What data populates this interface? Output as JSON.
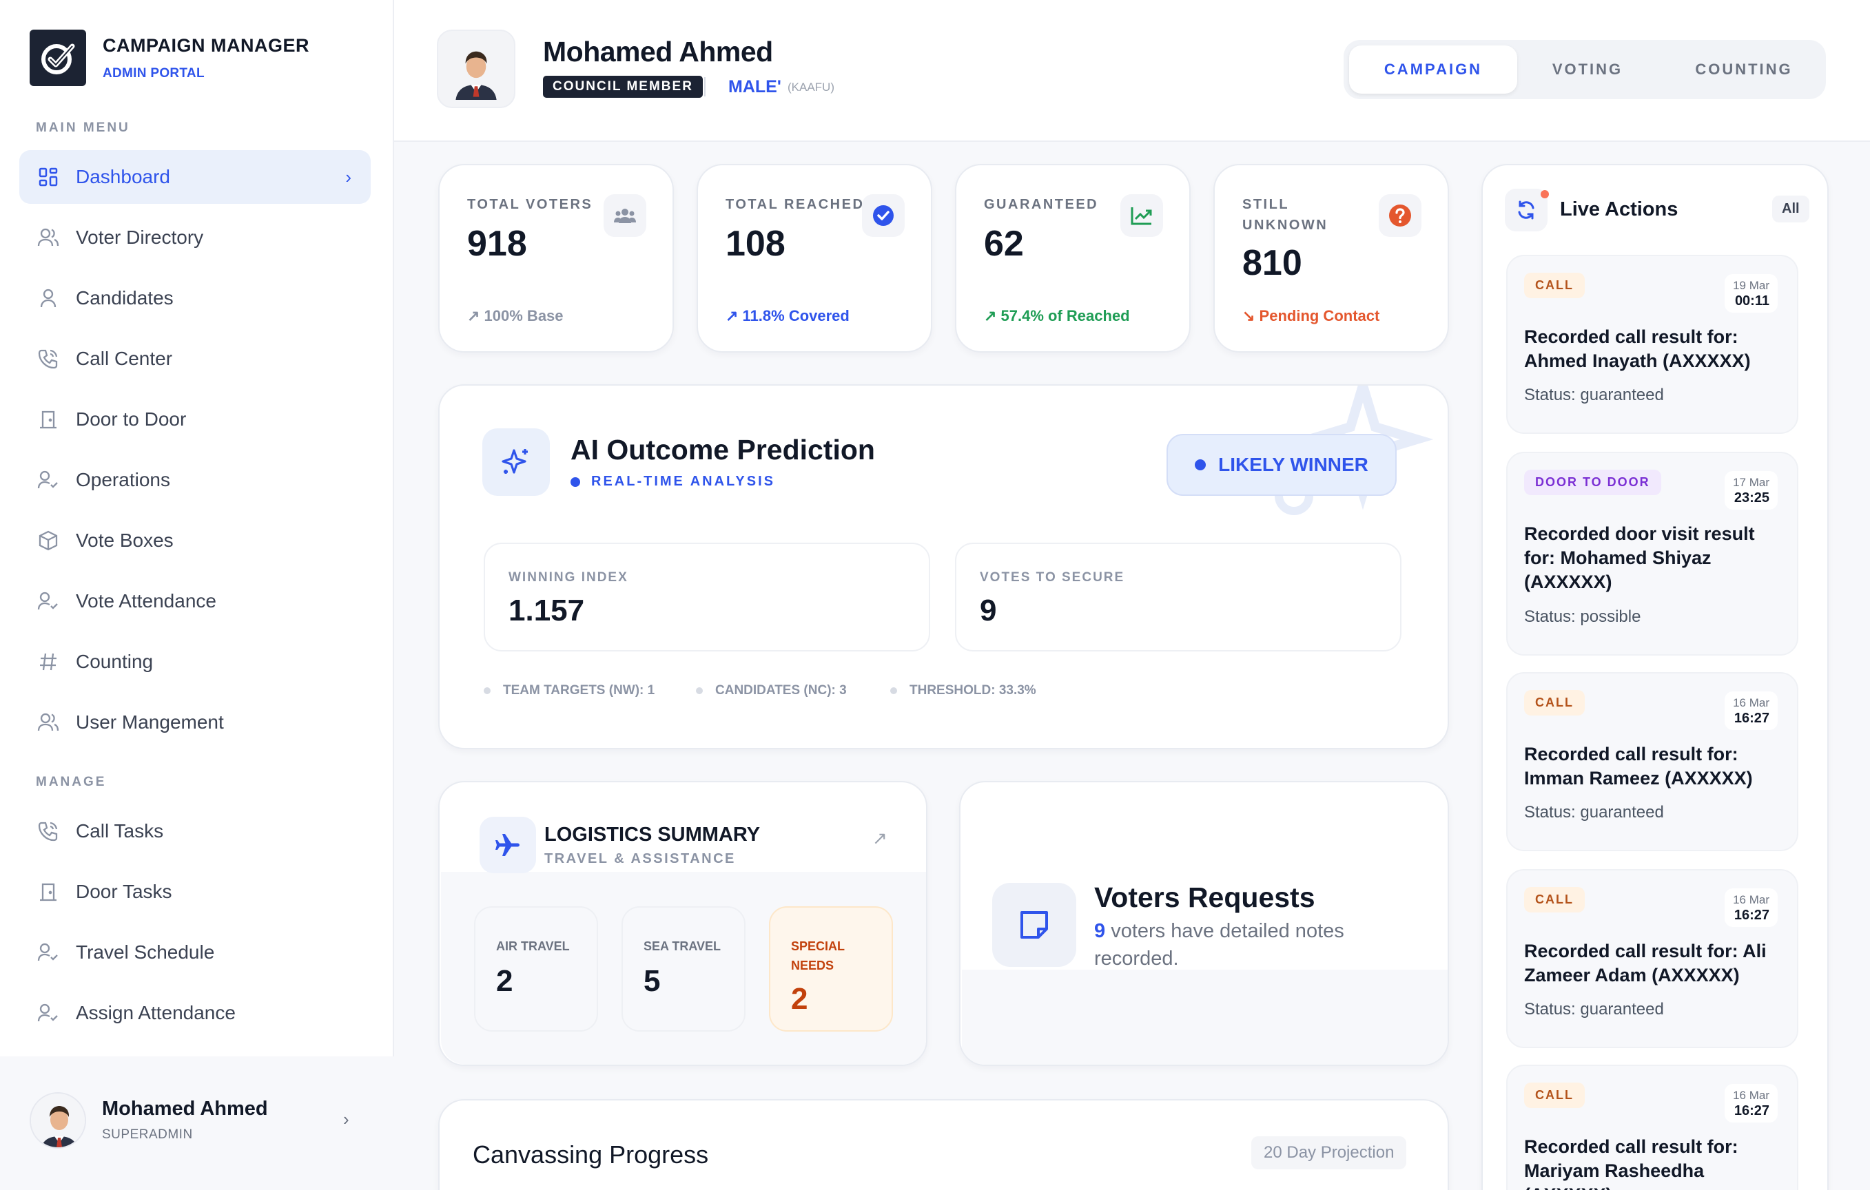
{
  "brand": {
    "title": "CAMPAIGN MANAGER",
    "subtitle": "ADMIN PORTAL"
  },
  "sidebar": {
    "main_label": "MAIN MENU",
    "items": [
      {
        "label": "Dashboard",
        "icon": "grid-icon",
        "active": true
      },
      {
        "label": "Voter Directory",
        "icon": "users-icon"
      },
      {
        "label": "Candidates",
        "icon": "user-icon"
      },
      {
        "label": "Call Center",
        "icon": "phone-icon"
      },
      {
        "label": "Door to Door",
        "icon": "door-icon"
      },
      {
        "label": "Operations",
        "icon": "user-check-icon"
      },
      {
        "label": "Vote Boxes",
        "icon": "box-icon"
      },
      {
        "label": "Vote Attendance",
        "icon": "user-check-icon"
      },
      {
        "label": "Counting",
        "icon": "hash-icon"
      },
      {
        "label": "User Mangement",
        "icon": "users-icon"
      }
    ],
    "manage_label": "MANAGE",
    "manage_items": [
      {
        "label": "Call Tasks",
        "icon": "phone-icon"
      },
      {
        "label": "Door Tasks",
        "icon": "door-icon"
      },
      {
        "label": "Travel Schedule",
        "icon": "user-check-icon"
      },
      {
        "label": "Assign Attendance",
        "icon": "user-check-icon"
      }
    ],
    "user": {
      "name": "Mohamed Ahmed",
      "role": "SUPERADMIN"
    }
  },
  "header": {
    "name": "Mohamed Ahmed",
    "badge": "COUNCIL MEMBER",
    "location": "MALE'",
    "location_sub": "(KAAFU)",
    "tabs": [
      {
        "label": "CAMPAIGN",
        "active": true
      },
      {
        "label": "VOTING"
      },
      {
        "label": "COUNTING"
      }
    ]
  },
  "stats": [
    {
      "label": "TOTAL VOTERS",
      "value": "918",
      "sub": "100% Base",
      "sub_color": "#8b93a4",
      "icon": "users-icon"
    },
    {
      "label": "TOTAL REACHED",
      "value": "108",
      "sub": "11.8% Covered",
      "sub_color": "#2f54eb",
      "icon": "check-circle-icon"
    },
    {
      "label": "GUARANTEED",
      "value": "62",
      "sub": "57.4% of Reached",
      "sub_color": "#1f9d55",
      "icon": "trending-up-icon"
    },
    {
      "label_line1": "STILL",
      "label_line2": "UNKNOWN",
      "value": "810",
      "sub": "Pending Contact",
      "sub_color": "#e4572e",
      "icon": "question-icon"
    }
  ],
  "ai": {
    "title": "AI Outcome Prediction",
    "subtitle": "REAL-TIME ANALYSIS",
    "badge": "LIKELY WINNER",
    "winning_index_label": "WINNING INDEX",
    "winning_index": "1.157",
    "votes_secure_label": "VOTES TO SECURE",
    "votes_secure": "9",
    "meta": [
      "TEAM TARGETS (NW): 1",
      "CANDIDATES (NC): 3",
      "THRESHOLD: 33.3%"
    ]
  },
  "logistics": {
    "title": "LOGISTICS SUMMARY",
    "subtitle": "TRAVEL & ASSISTANCE",
    "air_label": "AIR TRAVEL",
    "air": "2",
    "sea_label": "SEA TRAVEL",
    "sea": "5",
    "special_label_1": "SPECIAL",
    "special_label_2": "NEEDS",
    "special": "2"
  },
  "requests": {
    "title": "Voters Requests",
    "count": "9",
    "text_1": " voters have detailed notes",
    "text_2": "recorded."
  },
  "canvassing": {
    "title": "Canvassing Progress",
    "projection": "20 Day Projection"
  },
  "feed": {
    "title": "Live Actions",
    "filter": "All",
    "items": [
      {
        "tag": "CALL",
        "type": "call",
        "date": "19 Mar",
        "time": "00:11",
        "text": "Recorded call result for: Ahmed Inayath (AXXXXX)",
        "status": "Status: guaranteed"
      },
      {
        "tag": "DOOR TO DOOR",
        "type": "door",
        "date": "17 Mar",
        "time": "23:25",
        "text": "Recorded door visit result for: Mohamed Shiyaz (AXXXXX)",
        "status": "Status: possible"
      },
      {
        "tag": "CALL",
        "type": "call",
        "date": "16 Mar",
        "time": "16:27",
        "text": "Recorded call result for: Imman Rameez (AXXXXX)",
        "status": "Status: guaranteed"
      },
      {
        "tag": "CALL",
        "type": "call",
        "date": "16 Mar",
        "time": "16:27",
        "text": "Recorded call result for: Ali Zameer Adam (AXXXXX)",
        "status": "Status: guaranteed"
      },
      {
        "tag": "CALL",
        "type": "call",
        "date": "16 Mar",
        "time": "16:27",
        "text": "Recorded call result for: Mariyam Rasheedha (AXXXXX)",
        "status": ""
      }
    ]
  }
}
